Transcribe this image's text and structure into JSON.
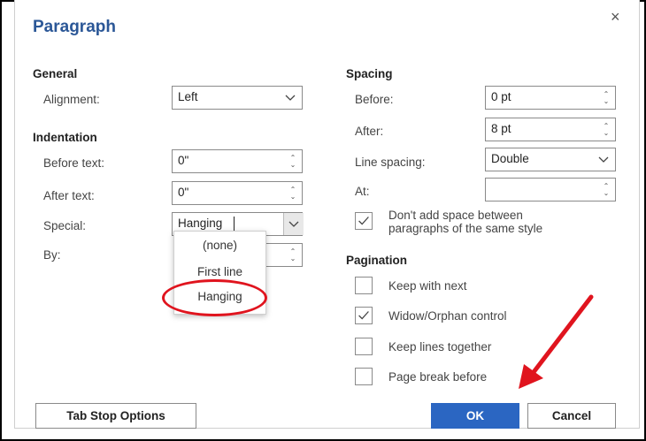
{
  "dialog": {
    "title": "Paragraph",
    "close_glyph": "×"
  },
  "general": {
    "heading": "General",
    "alignment_label": "Alignment:",
    "alignment_value": "Left"
  },
  "indentation": {
    "heading": "Indentation",
    "before_text_label": "Before text:",
    "before_text_value": "0\"",
    "after_text_label": "After text:",
    "after_text_value": "0\"",
    "special_label": "Special:",
    "special_value": "Hanging",
    "by_label": "By:",
    "special_options": [
      "(none)",
      "First line",
      "Hanging"
    ]
  },
  "spacing": {
    "heading": "Spacing",
    "before_label": "Before:",
    "before_value": "0 pt",
    "after_label": "After:",
    "after_value": "8 pt",
    "line_spacing_label": "Line spacing:",
    "line_spacing_value": "Double",
    "at_label": "At:",
    "at_value": "",
    "dont_add_space_label_line1": "Don't add space between",
    "dont_add_space_label_line2": "paragraphs of the same style",
    "dont_add_space_checked": true
  },
  "pagination": {
    "heading": "Pagination",
    "keep_with_next_label": "Keep with next",
    "keep_with_next_checked": false,
    "widow_orphan_label": "Widow/Orphan control",
    "widow_orphan_checked": true,
    "keep_lines_together_label": "Keep lines together",
    "keep_lines_together_checked": false,
    "page_break_before_label": "Page break before",
    "page_break_before_checked": false
  },
  "buttons": {
    "tab_stop_options": "Tab Stop Options",
    "ok": "OK",
    "cancel": "Cancel"
  },
  "colors": {
    "title": "#2b5797",
    "primary_button": "#2b66c2",
    "annotation": "#e0141e"
  },
  "icons": [
    "close-icon",
    "chevron-down-icon",
    "spin-up-icon",
    "spin-down-icon",
    "checkmark-icon",
    "annotation-arrow-icon",
    "annotation-circle"
  ]
}
